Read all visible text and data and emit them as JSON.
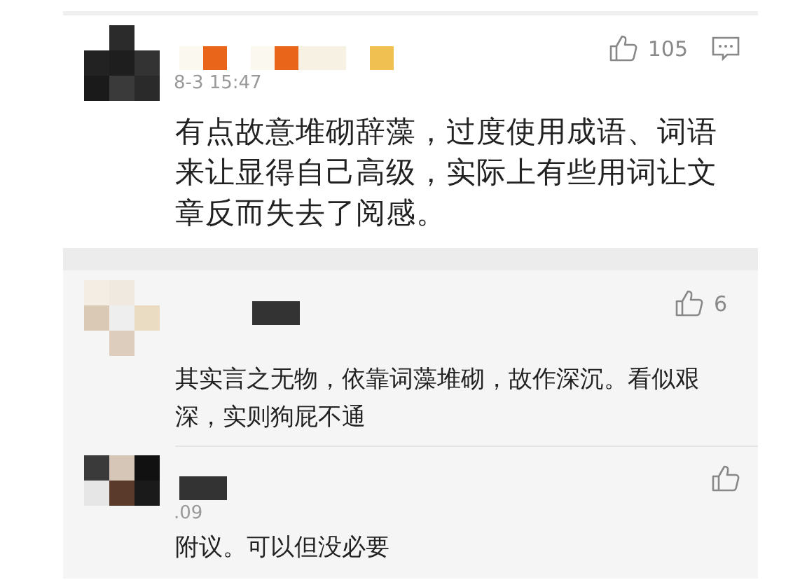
{
  "comment": {
    "date": "8-3 15:47",
    "likes": "105",
    "text": "有点故意堆砌辞藻，过度使用成语、词语来让显得自己高级，实际上有些用词让文章反而失去了阅感。"
  },
  "replies": [
    {
      "likes": "6",
      "text": "其实言之无物，依靠词藻堆砌，故作深沉。看似艰深，实则狗屁不通"
    },
    {
      "date": ".09",
      "text": "附议。可以但没必要"
    }
  ]
}
